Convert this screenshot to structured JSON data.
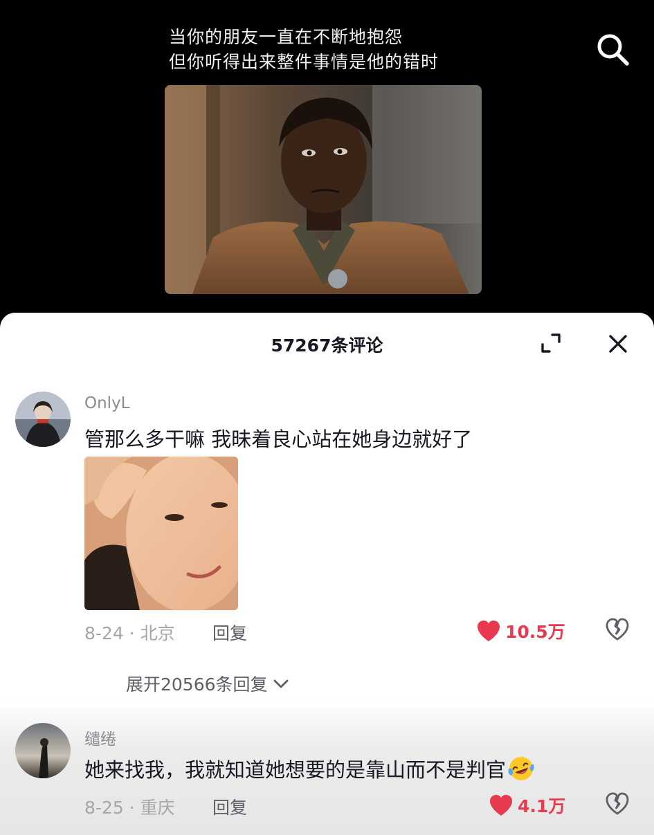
{
  "video": {
    "caption_line1": "当你的朋友一直在不断地抱怨",
    "caption_line2": "但你听得出来整件事情是他的错时"
  },
  "icons": {
    "search": "search-icon",
    "expand": "expand-icon",
    "close": "close-icon",
    "like": "heart-icon",
    "dislike": "broken-heart-icon",
    "chevron": "chevron-down-icon",
    "emoji": "laughing-tears-emoji"
  },
  "comments_panel": {
    "title": "57267条评论",
    "comments": [
      {
        "username": "OnlyL",
        "text": "管那么多干嘛 我昧着良心站在她身边就好了",
        "date_location": "8-24 · 北京",
        "reply_label": "回复",
        "likes": "10.5万",
        "expand_replies": "展开20566条回复"
      },
      {
        "username": "缱绻",
        "text": "她来找我，我就知道她想要的是靠山而不是判官",
        "date_location": "8-25 · 重庆",
        "reply_label": "回复",
        "likes": "4.1万"
      }
    ]
  },
  "colors": {
    "like_red": "#e8394f",
    "text_primary": "#161823",
    "text_secondary": "#8a8b91"
  }
}
